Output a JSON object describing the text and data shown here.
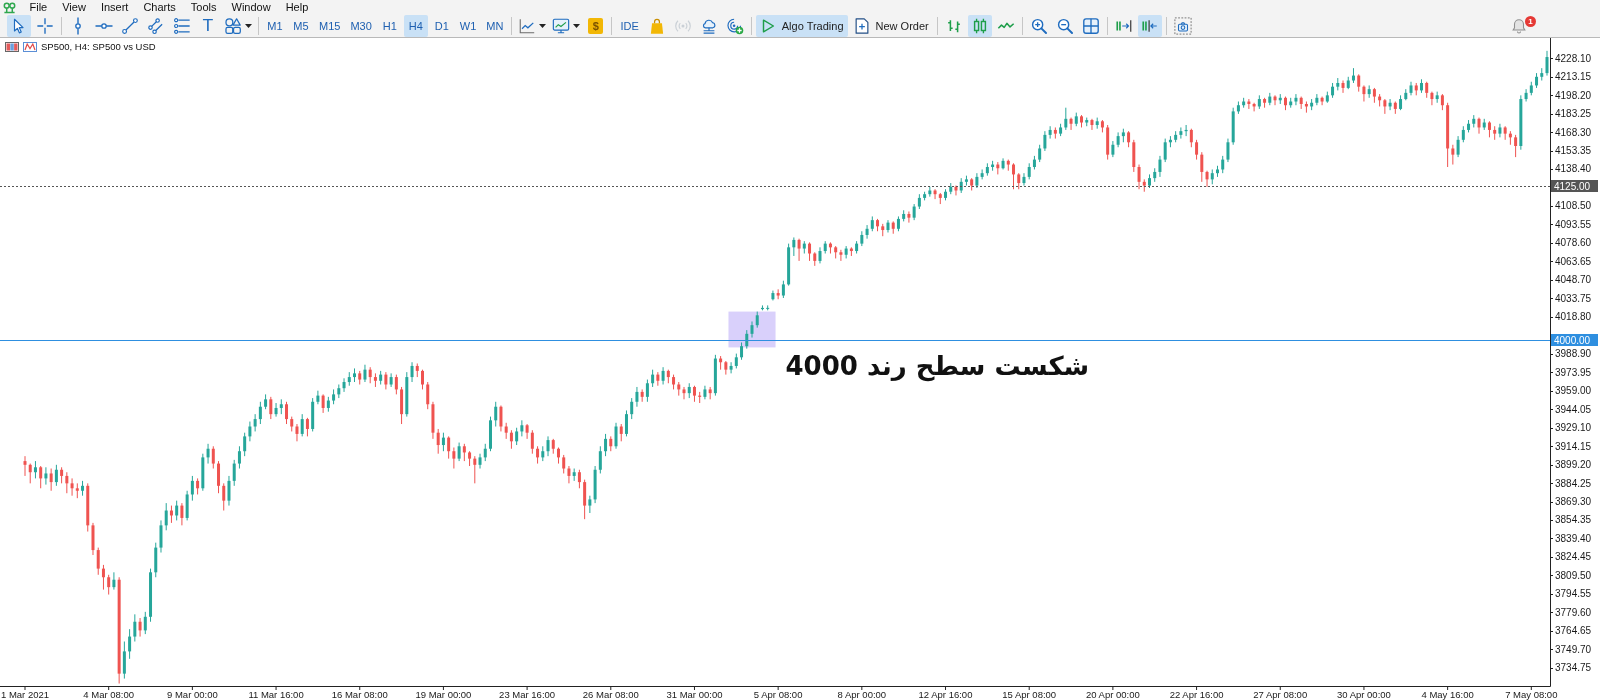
{
  "menu": [
    "File",
    "View",
    "Insert",
    "Charts",
    "Tools",
    "Window",
    "Help"
  ],
  "toolbar": [
    [
      {
        "kind": "cursor",
        "selected": true
      },
      {
        "kind": "crosshair",
        "selected": false
      }
    ],
    [
      {
        "kind": "vline",
        "selected": false
      },
      {
        "kind": "hline",
        "selected": false
      },
      {
        "kind": "trendline",
        "selected": false
      },
      {
        "kind": "channel",
        "selected": false
      },
      {
        "kind": "fibo",
        "selected": false
      },
      {
        "kind": "texttool",
        "label": "T",
        "selected": false
      },
      {
        "kind": "shapes",
        "dropdown": true,
        "selected": false
      }
    ],
    [
      {
        "kind": "timeframe",
        "label": "M1",
        "selected": false
      },
      {
        "kind": "timeframe",
        "label": "M5",
        "selected": false
      },
      {
        "kind": "timeframe",
        "label": "M15",
        "selected": false
      },
      {
        "kind": "timeframe",
        "label": "M30",
        "selected": false
      },
      {
        "kind": "timeframe",
        "label": "H1",
        "selected": false
      },
      {
        "kind": "timeframe",
        "label": "H4",
        "selected": true
      },
      {
        "kind": "timeframe",
        "label": "D1",
        "selected": false
      },
      {
        "kind": "timeframe",
        "label": "W1",
        "selected": false
      },
      {
        "kind": "timeframe",
        "label": "MN",
        "selected": false
      }
    ],
    [
      {
        "kind": "indicators",
        "dropdown": true
      },
      {
        "kind": "templates",
        "dropdown": true
      },
      {
        "kind": "dollar",
        "label": "$"
      }
    ],
    [
      {
        "kind": "ide",
        "label": "IDE",
        "disabled": false
      },
      {
        "kind": "market",
        "disabled": false
      },
      {
        "kind": "signals",
        "disabled": true
      },
      {
        "kind": "vps",
        "disabled": false
      },
      {
        "kind": "radar",
        "disabled": false
      }
    ],
    [
      {
        "kind": "algo",
        "label": "Algo Trading",
        "selected": true
      },
      {
        "kind": "order",
        "label": "New Order",
        "selected": false
      }
    ],
    [
      {
        "kind": "bars",
        "selected": false
      },
      {
        "kind": "candles",
        "selected": true
      },
      {
        "kind": "line",
        "selected": false
      }
    ],
    [
      {
        "kind": "zoomin"
      },
      {
        "kind": "zoomout"
      },
      {
        "kind": "tile"
      }
    ],
    [
      {
        "kind": "autoscroll",
        "selected": false
      },
      {
        "kind": "shift",
        "selected": true
      }
    ],
    [
      {
        "kind": "screenshot"
      }
    ]
  ],
  "notifications": {
    "badge": "1"
  },
  "chart": {
    "symbol": "SP500, H4: SP500 vs USD",
    "chart_data": {
      "type": "candlestick",
      "ylim": [
        3720,
        4244.4
      ],
      "categories": [
        "1 Mar 2021",
        null,
        null,
        null,
        null,
        null,
        null,
        null,
        null,
        null,
        null,
        null,
        null,
        null,
        null,
        null,
        "4 Mar 08:00",
        null,
        null,
        null,
        null,
        null,
        null,
        null,
        null,
        null,
        null,
        null,
        null,
        null,
        null,
        null,
        "9 Mar 00:00",
        null,
        null,
        null,
        null,
        null,
        null,
        null,
        null,
        null,
        null,
        null,
        null,
        null,
        null,
        null,
        "11 Mar 16:00",
        null,
        null,
        null,
        null,
        null,
        null,
        null,
        null,
        null,
        null,
        null,
        null,
        null,
        null,
        null,
        "16 Mar 08:00",
        null,
        null,
        null,
        null,
        null,
        null,
        null,
        null,
        null,
        null,
        null,
        null,
        null,
        null,
        null,
        "19 Mar 00:00",
        null,
        null,
        null,
        null,
        null,
        null,
        null,
        null,
        null,
        null,
        null,
        null,
        null,
        null,
        null,
        "23 Mar 16:00",
        null,
        null,
        null,
        null,
        null,
        null,
        null,
        null,
        null,
        null,
        null,
        null,
        null,
        null,
        null,
        "26 Mar 08:00",
        null,
        null,
        null,
        null,
        null,
        null,
        null,
        null,
        null,
        null,
        null,
        null,
        null,
        null,
        null,
        "31 Mar 00:00",
        null,
        null,
        null,
        null,
        null,
        null,
        null,
        null,
        null,
        null,
        null,
        null,
        null,
        null,
        null,
        "5 Apr 08:00",
        null,
        null,
        null,
        null,
        null,
        null,
        null,
        null,
        null,
        null,
        null,
        null,
        null,
        null,
        null,
        "8 Apr 00:00",
        null,
        null,
        null,
        null,
        null,
        null,
        null,
        null,
        null,
        null,
        null,
        null,
        null,
        null,
        null,
        "12 Apr 16:00",
        null,
        null,
        null,
        null,
        null,
        null,
        null,
        null,
        null,
        null,
        null,
        null,
        null,
        null,
        null,
        "15 Apr 08:00",
        null,
        null,
        null,
        null,
        null,
        null,
        null,
        null,
        null,
        null,
        null,
        null,
        null,
        null,
        null,
        "20 Apr 00:00",
        null,
        null,
        null,
        null,
        null,
        null,
        null,
        null,
        null,
        null,
        null,
        null,
        null,
        null,
        null,
        "22 Apr 16:00",
        null,
        null,
        null,
        null,
        null,
        null,
        null,
        null,
        null,
        null,
        null,
        null,
        null,
        null,
        null,
        "27 Apr 08:00",
        null,
        null,
        null,
        null,
        null,
        null,
        null,
        null,
        null,
        null,
        null,
        null,
        null,
        null,
        null,
        "30 Apr 00:00",
        null,
        null,
        null,
        null,
        null,
        null,
        null,
        null,
        null,
        null,
        null,
        null,
        null,
        null,
        null,
        "4 May 16:00",
        null,
        null,
        null,
        null,
        null,
        null,
        null,
        null,
        null,
        null,
        null,
        null,
        null,
        null,
        null,
        "7 May 08:00",
        null,
        null,
        null
      ],
      "yticks": [
        {
          "value": 4228.1,
          "label": "4228.10"
        },
        {
          "value": 4213.15,
          "label": "4213.15"
        },
        {
          "value": 4198.2,
          "label": "4198.20"
        },
        {
          "value": 4183.25,
          "label": "4183.25"
        },
        {
          "value": 4168.3,
          "label": "4168.30"
        },
        {
          "value": 4153.35,
          "label": "4153.35"
        },
        {
          "value": 4138.4,
          "label": "4138.40"
        },
        {
          "value": 4108.5,
          "label": "4108.50"
        },
        {
          "value": 4093.55,
          "label": "4093.55"
        },
        {
          "value": 4078.6,
          "label": "4078.60"
        },
        {
          "value": 4063.65,
          "label": "4063.65"
        },
        {
          "value": 4048.7,
          "label": "4048.70"
        },
        {
          "value": 4033.75,
          "label": "4033.75"
        },
        {
          "value": 4018.8,
          "label": "4018.80"
        },
        {
          "value": 3988.9,
          "label": "3988.90"
        },
        {
          "value": 3973.95,
          "label": "3973.95"
        },
        {
          "value": 3959,
          "label": "3959.00"
        },
        {
          "value": 3944.05,
          "label": "3944.05"
        },
        {
          "value": 3929.1,
          "label": "3929.10"
        },
        {
          "value": 3914.15,
          "label": "3914.15"
        },
        {
          "value": 3899.2,
          "label": "3899.20"
        },
        {
          "value": 3884.25,
          "label": "3884.25"
        },
        {
          "value": 3869.3,
          "label": "3869.30"
        },
        {
          "value": 3854.35,
          "label": "3854.35"
        },
        {
          "value": 3839.4,
          "label": "3839.40"
        },
        {
          "value": 3824.45,
          "label": "3824.45"
        },
        {
          "value": 3809.5,
          "label": "3809.50"
        },
        {
          "value": 3794.55,
          "label": "3794.55"
        },
        {
          "value": 3779.6,
          "label": "3779.60"
        },
        {
          "value": 3764.65,
          "label": "3764.65"
        },
        {
          "value": 3749.7,
          "label": "3749.70"
        },
        {
          "value": 3734.75,
          "label": "3734.75"
        }
      ],
      "ohlc": [
        [
          3902,
          3906,
          3890,
          3899
        ],
        [
          3899,
          3900,
          3884,
          3893
        ],
        [
          3893,
          3902,
          3888,
          3897
        ],
        [
          3897,
          3898,
          3880,
          3888
        ],
        [
          3888,
          3897,
          3883,
          3892
        ],
        [
          3892,
          3896,
          3878,
          3885
        ],
        [
          3885,
          3899,
          3882,
          3895
        ],
        [
          3895,
          3897,
          3884,
          3890
        ],
        [
          3890,
          3893,
          3876,
          3884
        ],
        [
          3884,
          3888,
          3874,
          3880
        ],
        [
          3880,
          3884,
          3872,
          3878
        ],
        [
          3878,
          3886,
          3874,
          3882
        ],
        [
          3882,
          3884,
          3845,
          3850
        ],
        [
          3850,
          3852,
          3826,
          3830
        ],
        [
          3830,
          3832,
          3810,
          3815
        ],
        [
          3815,
          3818,
          3798,
          3808
        ],
        [
          3808,
          3810,
          3794,
          3800
        ],
        [
          3800,
          3812,
          3798,
          3806
        ],
        [
          3806,
          3808,
          3722,
          3730
        ],
        [
          3730,
          3756,
          3726,
          3748
        ],
        [
          3748,
          3766,
          3742,
          3760
        ],
        [
          3760,
          3778,
          3756,
          3772
        ],
        [
          3772,
          3775,
          3760,
          3765
        ],
        [
          3765,
          3780,
          3762,
          3776
        ],
        [
          3776,
          3815,
          3772,
          3812
        ],
        [
          3812,
          3836,
          3808,
          3832
        ],
        [
          3832,
          3854,
          3828,
          3850
        ],
        [
          3850,
          3868,
          3846,
          3862
        ],
        [
          3862,
          3866,
          3852,
          3858
        ],
        [
          3858,
          3870,
          3854,
          3866
        ],
        [
          3866,
          3868,
          3850,
          3856
        ],
        [
          3856,
          3878,
          3854,
          3875
        ],
        [
          3875,
          3890,
          3870,
          3886
        ],
        [
          3886,
          3888,
          3875,
          3880
        ],
        [
          3880,
          3908,
          3878,
          3905
        ],
        [
          3905,
          3916,
          3900,
          3912
        ],
        [
          3912,
          3914,
          3896,
          3900
        ],
        [
          3900,
          3902,
          3876,
          3882
        ],
        [
          3882,
          3884,
          3862,
          3870
        ],
        [
          3870,
          3890,
          3866,
          3886
        ],
        [
          3886,
          3903,
          3882,
          3900
        ],
        [
          3900,
          3914,
          3896,
          3910
        ],
        [
          3910,
          3925,
          3906,
          3922
        ],
        [
          3922,
          3934,
          3918,
          3930
        ],
        [
          3930,
          3940,
          3926,
          3936
        ],
        [
          3936,
          3950,
          3932,
          3946
        ],
        [
          3946,
          3956,
          3944,
          3952
        ],
        [
          3952,
          3954,
          3936,
          3940
        ],
        [
          3940,
          3949,
          3938,
          3945
        ],
        [
          3945,
          3952,
          3940,
          3948
        ],
        [
          3948,
          3950,
          3932,
          3936
        ],
        [
          3936,
          3938,
          3926,
          3930
        ],
        [
          3930,
          3932,
          3918,
          3924
        ],
        [
          3924,
          3940,
          3922,
          3936
        ],
        [
          3936,
          3937,
          3922,
          3928
        ],
        [
          3928,
          3953,
          3926,
          3950
        ],
        [
          3950,
          3959,
          3948,
          3955
        ],
        [
          3955,
          3956,
          3941,
          3945
        ],
        [
          3945,
          3954,
          3942,
          3951
        ],
        [
          3951,
          3960,
          3948,
          3956
        ],
        [
          3956,
          3964,
          3953,
          3961
        ],
        [
          3961,
          3969,
          3958,
          3966
        ],
        [
          3966,
          3974,
          3963,
          3970
        ],
        [
          3970,
          3977,
          3966,
          3973
        ],
        [
          3973,
          3975,
          3964,
          3968
        ],
        [
          3968,
          3980,
          3966,
          3976
        ],
        [
          3976,
          3978,
          3965,
          3970
        ],
        [
          3970,
          3973,
          3962,
          3967
        ],
        [
          3967,
          3975,
          3964,
          3972
        ],
        [
          3972,
          3974,
          3960,
          3964
        ],
        [
          3964,
          3973,
          3962,
          3970
        ],
        [
          3970,
          3972,
          3956,
          3960
        ],
        [
          3960,
          3962,
          3932,
          3940
        ],
        [
          3940,
          3974,
          3938,
          3970
        ],
        [
          3970,
          3982,
          3966,
          3979
        ],
        [
          3979,
          3981,
          3970,
          3975
        ],
        [
          3975,
          3976,
          3960,
          3964
        ],
        [
          3964,
          3966,
          3944,
          3948
        ],
        [
          3948,
          3950,
          3920,
          3925
        ],
        [
          3925,
          3928,
          3908,
          3915
        ],
        [
          3915,
          3925,
          3910,
          3921
        ],
        [
          3921,
          3922,
          3904,
          3910
        ],
        [
          3910,
          3913,
          3896,
          3904
        ],
        [
          3904,
          3917,
          3902,
          3914
        ],
        [
          3914,
          3916,
          3902,
          3909
        ],
        [
          3909,
          3910,
          3898,
          3904
        ],
        [
          3904,
          3906,
          3884,
          3899
        ],
        [
          3899,
          3908,
          3896,
          3905
        ],
        [
          3905,
          3916,
          3902,
          3912
        ],
        [
          3912,
          3938,
          3910,
          3935
        ],
        [
          3935,
          3950,
          3930,
          3946
        ],
        [
          3946,
          3947,
          3926,
          3930
        ],
        [
          3930,
          3933,
          3920,
          3925
        ],
        [
          3925,
          3927,
          3912,
          3918
        ],
        [
          3918,
          3929,
          3915,
          3926
        ],
        [
          3926,
          3935,
          3922,
          3931
        ],
        [
          3931,
          3932,
          3920,
          3925
        ],
        [
          3925,
          3927,
          3908,
          3912
        ],
        [
          3912,
          3914,
          3900,
          3905
        ],
        [
          3905,
          3914,
          3902,
          3910
        ],
        [
          3910,
          3922,
          3906,
          3919
        ],
        [
          3919,
          3920,
          3908,
          3912
        ],
        [
          3912,
          3913,
          3900,
          3905
        ],
        [
          3905,
          3907,
          3892,
          3896
        ],
        [
          3896,
          3898,
          3884,
          3890
        ],
        [
          3890,
          3896,
          3886,
          3893
        ],
        [
          3893,
          3895,
          3880,
          3885
        ],
        [
          3885,
          3887,
          3855,
          3866
        ],
        [
          3866,
          3874,
          3860,
          3871
        ],
        [
          3871,
          3898,
          3868,
          3895
        ],
        [
          3895,
          3914,
          3892,
          3910
        ],
        [
          3910,
          3924,
          3906,
          3920
        ],
        [
          3920,
          3922,
          3910,
          3914
        ],
        [
          3914,
          3933,
          3912,
          3930
        ],
        [
          3930,
          3932,
          3918,
          3924
        ],
        [
          3924,
          3943,
          3922,
          3940
        ],
        [
          3940,
          3953,
          3936,
          3950
        ],
        [
          3950,
          3962,
          3946,
          3958
        ],
        [
          3958,
          3960,
          3950,
          3954
        ],
        [
          3954,
          3968,
          3950,
          3965
        ],
        [
          3965,
          3976,
          3962,
          3972
        ],
        [
          3972,
          3974,
          3963,
          3967
        ],
        [
          3967,
          3978,
          3964,
          3975
        ],
        [
          3975,
          3976,
          3965,
          3970
        ],
        [
          3970,
          3972,
          3960,
          3964
        ],
        [
          3964,
          3966,
          3955,
          3960
        ],
        [
          3960,
          3962,
          3952,
          3957
        ],
        [
          3957,
          3965,
          3953,
          3962
        ],
        [
          3962,
          3963,
          3950,
          3955
        ],
        [
          3955,
          3958,
          3949,
          3954
        ],
        [
          3954,
          3963,
          3952,
          3960
        ],
        [
          3960,
          3962,
          3952,
          3957
        ],
        [
          3957,
          3988,
          3955,
          3985
        ],
        [
          3985,
          3987,
          3976,
          3982
        ],
        [
          3982,
          3983,
          3972,
          3976
        ],
        [
          3976,
          3982,
          3973,
          3979
        ],
        [
          3979,
          3989,
          3977,
          3986
        ],
        [
          3986,
          3998,
          3984,
          3995
        ],
        [
          3995,
          4008,
          3993,
          4005
        ],
        [
          4005,
          4015,
          4002,
          4012
        ],
        [
          4012,
          4023,
          4010,
          4020
        ],
        [
          4025,
          4028,
          4024,
          4026
        ],
        [
          4026,
          4028,
          4024,
          4026
        ],
        [
          4033,
          4040,
          4032,
          4038
        ],
        [
          4038,
          4041,
          4033,
          4036
        ],
        [
          4036,
          4048,
          4034,
          4045
        ],
        [
          4045,
          4078,
          4044,
          4075
        ],
        [
          4075,
          4083,
          4068,
          4081
        ],
        [
          4081,
          4082,
          4064,
          4074
        ],
        [
          4074,
          4080,
          4070,
          4078
        ],
        [
          4078,
          4079,
          4064,
          4070
        ],
        [
          4070,
          4071,
          4060,
          4064
        ],
        [
          4064,
          4075,
          4062,
          4072
        ],
        [
          4072,
          4080,
          4070,
          4078
        ],
        [
          4078,
          4079,
          4070,
          4075
        ],
        [
          4075,
          4076,
          4066,
          4071
        ],
        [
          4071,
          4073,
          4064,
          4069
        ],
        [
          4069,
          4076,
          4066,
          4074
        ],
        [
          4074,
          4075,
          4068,
          4072
        ],
        [
          4072,
          4080,
          4070,
          4078
        ],
        [
          4078,
          4088,
          4076,
          4085
        ],
        [
          4085,
          4093,
          4082,
          4090
        ],
        [
          4090,
          4100,
          4088,
          4097
        ],
        [
          4097,
          4098,
          4088,
          4092
        ],
        [
          4092,
          4094,
          4084,
          4089
        ],
        [
          4089,
          4097,
          4087,
          4095
        ],
        [
          4095,
          4096,
          4086,
          4090
        ],
        [
          4090,
          4100,
          4088,
          4098
        ],
        [
          4098,
          4105,
          4096,
          4102
        ],
        [
          4102,
          4104,
          4095,
          4099
        ],
        [
          4099,
          4110,
          4097,
          4108
        ],
        [
          4108,
          4118,
          4106,
          4115
        ],
        [
          4115,
          4120,
          4113,
          4118
        ],
        [
          4118,
          4124,
          4116,
          4121
        ],
        [
          4121,
          4122,
          4114,
          4118
        ],
        [
          4118,
          4119,
          4110,
          4115
        ],
        [
          4115,
          4122,
          4113,
          4120
        ],
        [
          4120,
          4127,
          4118,
          4124
        ],
        [
          4124,
          4125,
          4117,
          4121
        ],
        [
          4121,
          4131,
          4119,
          4128
        ],
        [
          4128,
          4133,
          4125,
          4130
        ],
        [
          4130,
          4131,
          4121,
          4125
        ],
        [
          4125,
          4135,
          4123,
          4132
        ],
        [
          4132,
          4138,
          4130,
          4135
        ],
        [
          4135,
          4143,
          4133,
          4140
        ],
        [
          4140,
          4145,
          4137,
          4142
        ],
        [
          4142,
          4144,
          4134,
          4139
        ],
        [
          4139,
          4147,
          4138,
          4145
        ],
        [
          4145,
          4146,
          4137,
          4142
        ],
        [
          4142,
          4143,
          4122,
          4134
        ],
        [
          4134,
          4135,
          4122,
          4127
        ],
        [
          4127,
          4135,
          4125,
          4132
        ],
        [
          4132,
          4143,
          4130,
          4140
        ],
        [
          4140,
          4149,
          4138,
          4146
        ],
        [
          4146,
          4158,
          4144,
          4155
        ],
        [
          4155,
          4169,
          4153,
          4166
        ],
        [
          4166,
          4173,
          4163,
          4170
        ],
        [
          4170,
          4172,
          4163,
          4167
        ],
        [
          4167,
          4175,
          4165,
          4172
        ],
        [
          4172,
          4188,
          4170,
          4179
        ],
        [
          4179,
          4180,
          4170,
          4175
        ],
        [
          4175,
          4184,
          4173,
          4181
        ],
        [
          4181,
          4182,
          4172,
          4176
        ],
        [
          4176,
          4180,
          4173,
          4178
        ],
        [
          4178,
          4179,
          4170,
          4174
        ],
        [
          4174,
          4180,
          4171,
          4177
        ],
        [
          4177,
          4178,
          4168,
          4172
        ],
        [
          4172,
          4174,
          4146,
          4150
        ],
        [
          4150,
          4161,
          4148,
          4158
        ],
        [
          4158,
          4168,
          4156,
          4165
        ],
        [
          4165,
          4171,
          4160,
          4168
        ],
        [
          4168,
          4169,
          4156,
          4160
        ],
        [
          4160,
          4162,
          4136,
          4140
        ],
        [
          4140,
          4142,
          4122,
          4128
        ],
        [
          4128,
          4130,
          4120,
          4125
        ],
        [
          4125,
          4134,
          4123,
          4131
        ],
        [
          4131,
          4139,
          4128,
          4136
        ],
        [
          4136,
          4149,
          4132,
          4146
        ],
        [
          4146,
          4163,
          4144,
          4160
        ],
        [
          4160,
          4165,
          4156,
          4162
        ],
        [
          4162,
          4169,
          4160,
          4166
        ],
        [
          4166,
          4172,
          4163,
          4169
        ],
        [
          4169,
          4174,
          4165,
          4170
        ],
        [
          4170,
          4171,
          4156,
          4160
        ],
        [
          4160,
          4162,
          4146,
          4150
        ],
        [
          4150,
          4152,
          4128,
          4136
        ],
        [
          4136,
          4137,
          4124,
          4130
        ],
        [
          4130,
          4138,
          4126,
          4135
        ],
        [
          4135,
          4141,
          4132,
          4138
        ],
        [
          4138,
          4149,
          4135,
          4146
        ],
        [
          4146,
          4163,
          4144,
          4160
        ],
        [
          4160,
          4188,
          4158,
          4185
        ],
        [
          4185,
          4193,
          4183,
          4190
        ],
        [
          4190,
          4196,
          4188,
          4193
        ],
        [
          4193,
          4195,
          4187,
          4191
        ],
        [
          4191,
          4192,
          4185,
          4189
        ],
        [
          4189,
          4198,
          4187,
          4195
        ],
        [
          4195,
          4196,
          4188,
          4192
        ],
        [
          4192,
          4200,
          4190,
          4197
        ],
        [
          4197,
          4198,
          4190,
          4194
        ],
        [
          4194,
          4199,
          4191,
          4196
        ],
        [
          4196,
          4197,
          4186,
          4190
        ],
        [
          4190,
          4196,
          4188,
          4193
        ],
        [
          4193,
          4199,
          4190,
          4196
        ],
        [
          4196,
          4197,
          4187,
          4191
        ],
        [
          4191,
          4193,
          4184,
          4189
        ],
        [
          4189,
          4195,
          4186,
          4192
        ],
        [
          4192,
          4199,
          4190,
          4196
        ],
        [
          4196,
          4197,
          4190,
          4193
        ],
        [
          4193,
          4201,
          4192,
          4198
        ],
        [
          4198,
          4208,
          4196,
          4205
        ],
        [
          4205,
          4212,
          4202,
          4208
        ],
        [
          4208,
          4210,
          4200,
          4204
        ],
        [
          4204,
          4213,
          4203,
          4210
        ],
        [
          4210,
          4220,
          4208,
          4214
        ],
        [
          4214,
          4215,
          4201,
          4205
        ],
        [
          4205,
          4206,
          4193,
          4199
        ],
        [
          4199,
          4206,
          4196,
          4203
        ],
        [
          4203,
          4204,
          4192,
          4197
        ],
        [
          4197,
          4199,
          4189,
          4194
        ],
        [
          4194,
          4195,
          4183,
          4189
        ],
        [
          4189,
          4195,
          4186,
          4192
        ],
        [
          4192,
          4193,
          4183,
          4187
        ],
        [
          4187,
          4198,
          4186,
          4195
        ],
        [
          4195,
          4203,
          4194,
          4200
        ],
        [
          4200,
          4209,
          4198,
          4206
        ],
        [
          4206,
          4208,
          4198,
          4202
        ],
        [
          4202,
          4211,
          4200,
          4208
        ],
        [
          4208,
          4209,
          4196,
          4200
        ],
        [
          4200,
          4201,
          4190,
          4195
        ],
        [
          4195,
          4201,
          4192,
          4198
        ],
        [
          4198,
          4199,
          4186,
          4190
        ],
        [
          4190,
          4192,
          4140,
          4155
        ],
        [
          4155,
          4158,
          4142,
          4150
        ],
        [
          4150,
          4165,
          4148,
          4162
        ],
        [
          4162,
          4173,
          4160,
          4170
        ],
        [
          4170,
          4178,
          4168,
          4175
        ],
        [
          4175,
          4182,
          4172,
          4179
        ],
        [
          4179,
          4180,
          4167,
          4172
        ],
        [
          4172,
          4179,
          4170,
          4176
        ],
        [
          4176,
          4177,
          4164,
          4170
        ],
        [
          4170,
          4173,
          4162,
          4167
        ],
        [
          4167,
          4175,
          4164,
          4172
        ],
        [
          4172,
          4173,
          4162,
          4167
        ],
        [
          4167,
          4169,
          4158,
          4164
        ],
        [
          4164,
          4166,
          4148,
          4157
        ],
        [
          4157,
          4198,
          4154,
          4195
        ],
        [
          4195,
          4203,
          4193,
          4200
        ],
        [
          4200,
          4209,
          4198,
          4206
        ],
        [
          4206,
          4216,
          4204,
          4213
        ],
        [
          4213,
          4220,
          4210,
          4216
        ],
        [
          4216,
          4234,
          4214,
          4229
        ]
      ],
      "ref_lines": [
        {
          "axis": "y",
          "value": 4125,
          "label": "4125.00",
          "color": "#555555"
        },
        {
          "axis": "y",
          "value": 4000,
          "label": "4000.00",
          "color": "#2e8fe0"
        }
      ],
      "annotations": [
        "شکست سطح رند 4000"
      ]
    }
  }
}
